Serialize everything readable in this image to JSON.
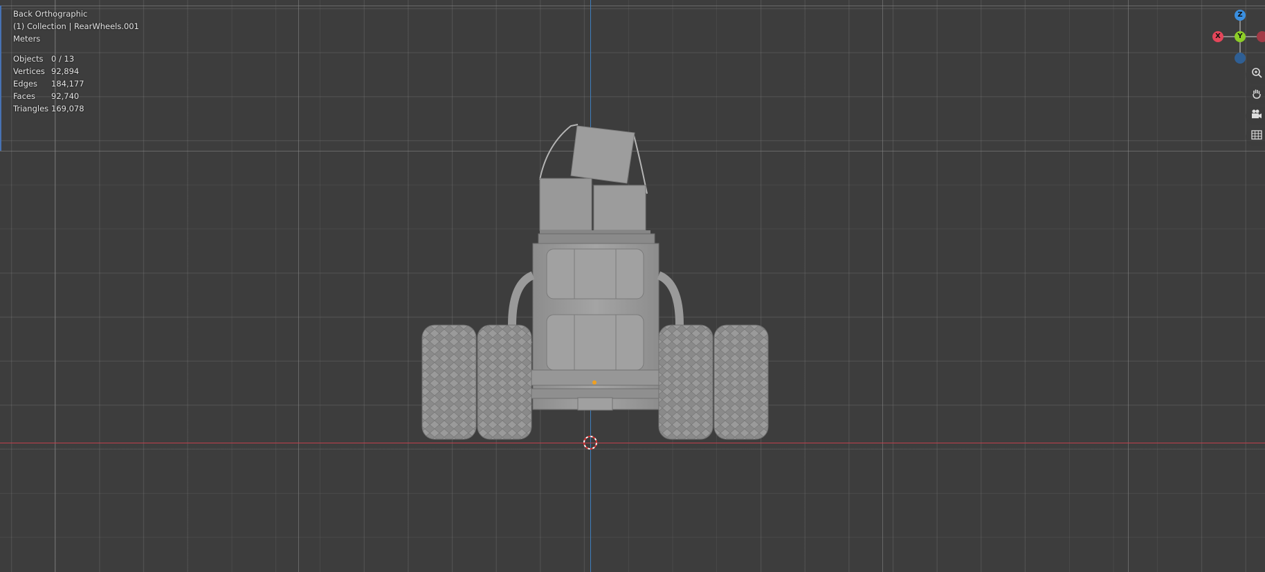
{
  "viewport": {
    "view_name": "Back Orthographic",
    "collection_label": "(1) Collection | RearWheels.001",
    "units": "Meters"
  },
  "stats": [
    {
      "label": "Objects",
      "value": "0 / 13"
    },
    {
      "label": "Vertices",
      "value": "92,894"
    },
    {
      "label": "Edges",
      "value": "184,177"
    },
    {
      "label": "Faces",
      "value": "92,740"
    },
    {
      "label": "Triangles",
      "value": "169,078"
    }
  ],
  "gizmo": {
    "z_label": "Z",
    "y_label": "Y",
    "x_label": "X",
    "colors": {
      "x": "#e5465a",
      "y": "#8ccd27",
      "z": "#3a8fe0"
    }
  },
  "nav_tools": {
    "zoom_icon": "zoom-icon",
    "pan_icon": "hand-icon",
    "camera_icon": "camera-icon",
    "ortho_icon": "grid-icon"
  }
}
